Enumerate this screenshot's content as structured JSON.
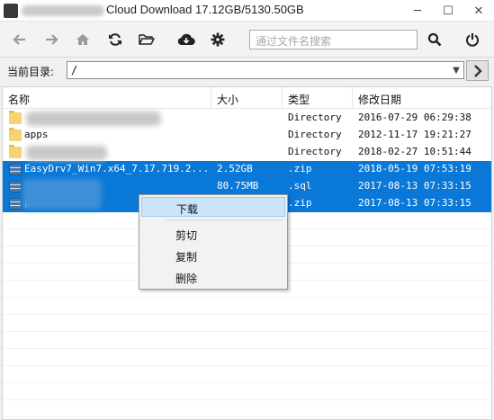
{
  "window": {
    "title": "Cloud Download 17.12GB/5130.50GB",
    "minimize_glyph": "─",
    "maximize_glyph": "☐",
    "close_glyph": "✕"
  },
  "toolbar": {
    "buttons": [
      "back-icon",
      "forward-icon",
      "home-icon",
      "refresh-icon",
      "open-folder-icon",
      "cloud-download-icon",
      "settings-icon"
    ],
    "search": {
      "placeholder": "通过文件名搜索",
      "value": ""
    },
    "search_button": "search-icon",
    "power_button": "power-icon"
  },
  "path": {
    "label": "当前目录:",
    "value": "/",
    "go_button": "arrow-right-icon"
  },
  "file_list": {
    "columns": [
      "名称",
      "大小",
      "类型",
      "修改日期"
    ],
    "rows": [
      {
        "name": "",
        "size": "",
        "type": "Directory",
        "date": "2016-07-29 06:29:38",
        "icon": "folder-icon",
        "selected": false
      },
      {
        "name": "apps",
        "size": "",
        "type": "Directory",
        "date": "2012-11-17 19:21:27",
        "icon": "folder-icon",
        "selected": false
      },
      {
        "name": "",
        "size": "",
        "type": "Directory",
        "date": "2018-02-27 10:51:44",
        "icon": "folder-icon",
        "selected": false
      },
      {
        "name": "EasyDrv7_Win7.x64_7.17.719.2...",
        "size": "2.52GB",
        "type": ".zip",
        "date": "2018-05-19 07:53:19",
        "icon": "archive-icon",
        "selected": true
      },
      {
        "name": "",
        "size": "80.75MB",
        "type": ".sql",
        "date": "2017-08-13 07:33:15",
        "icon": "archive-icon",
        "selected": true
      },
      {
        "name": "p",
        "size": "",
        "type": ".zip",
        "date": "2017-08-13 07:33:15",
        "icon": "archive-icon",
        "selected": true
      }
    ]
  },
  "context_menu": {
    "items": [
      "下载",
      "剪切",
      "复制",
      "删除"
    ],
    "highlighted_index": 0
  },
  "colors": {
    "selection": "#0a78d7",
    "menu_highlight": "#cce4f7"
  }
}
